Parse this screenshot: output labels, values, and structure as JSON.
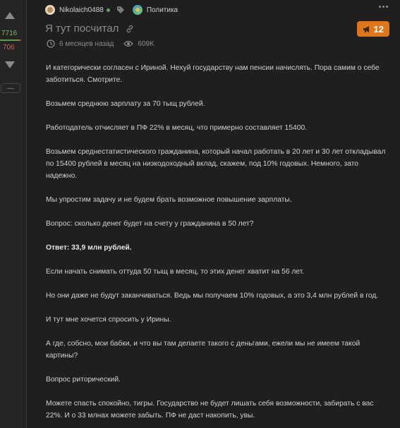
{
  "rating": {
    "plus": "7716",
    "minus": "706",
    "positive_share": 0.916,
    "more_label": "—"
  },
  "post": {
    "author": "Nikolaich0488",
    "community": "Политика",
    "title": "Я тут посчитал",
    "time_ago": "6 месяцев назад",
    "views": "609K",
    "comments_badge": "12",
    "paragraphs": [
      "И категорически согласен с Ириной. Нехуй государству нам пенсии начислять. Пора самим о себе заботиться. Смотрите.",
      "Возьмем среднюю зарплату за 70 тыщ рублей.",
      "Работодатель отчисляет в ПФ 22% в месяц, что примерно составляет 15400.",
      "Возьмем среднестатистического гражданина, который начал работать в 20 лет и 30 лет откладывал по 15400 рублей в месяц на низкодоходный вклад, скажем, под 10% годовых. Немного, зато надежно.",
      "Мы упростим задачу и не будем брать возможное повышение зарплаты.",
      "Вопрос: сколько денег будет на счету у гражданина в 50 лет?",
      "Ответ: 33,9 млн рублей.",
      "Если начать снимать оттуда 50 тыщ в месяц, то этих денег хватит на 56 лет.",
      "Но они даже не будут заканчиваться. Ведь мы получаем 10% годовых, а это 3,4 млн рублей в год.",
      "И тут мне хочется спросить у Ирины.",
      "А где, собсно, мои бабки, и что вы там делаете такого с деньгами, ежели мы не имеем такой картины?",
      "Вопрос риторический.",
      "Можете спасть спокойно, тигры. Государство не будет лишать себя возможности, забирать с вас 22%. И о 33 млнах можете забыть. ПФ не даст накопить, увы."
    ]
  },
  "icons": {
    "vote_up": "triangle-up-icon",
    "vote_down": "triangle-down-icon",
    "tag": "tag-icon",
    "link": "link-icon",
    "clock": "clock-icon",
    "views": "eye-icon",
    "more": "more-dots-icon",
    "badge": "megaphone-icon"
  },
  "colors": {
    "background": "#1f1f1f",
    "rail": "#242424",
    "plus": "#7fb56a",
    "minus": "#d06060",
    "badge": "#e0761b",
    "text": "#d2d2d2",
    "muted": "#8c8c8c"
  }
}
